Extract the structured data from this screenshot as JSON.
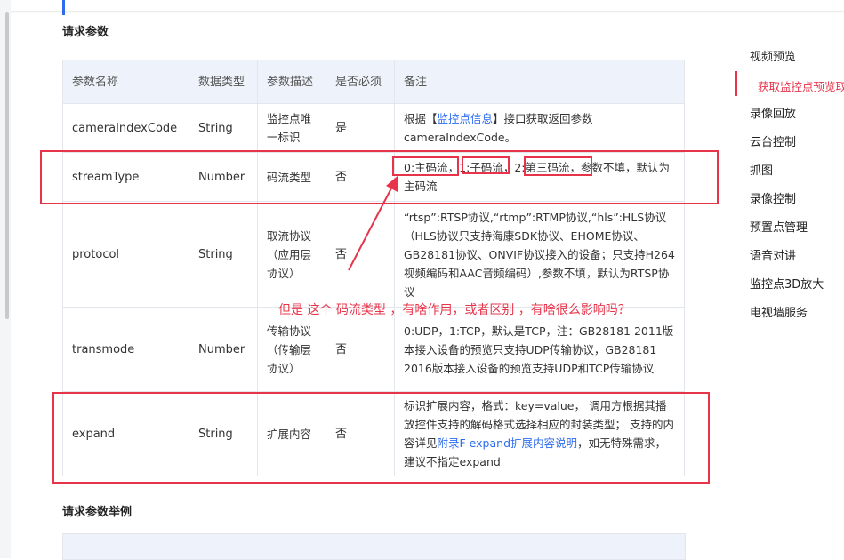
{
  "section_title": "请求参数",
  "table": {
    "headers": [
      "参数名称",
      "数据类型",
      "参数描述",
      "是否必须",
      "备注"
    ],
    "rows": [
      {
        "name": "cameraIndexCode",
        "type": "String",
        "desc": "监控点唯一标识",
        "required": "是",
        "note_prefix": "根据【",
        "note_link": "监控点信息",
        "note_suffix": "】接口获取返回参数cameraIndexCode。"
      },
      {
        "name": "streamType",
        "type": "Number",
        "desc": "码流类型",
        "required": "否",
        "note": "0:主码流，1:子码流，2:第三码流，参数不填，默认为主码流"
      },
      {
        "name": "protocol",
        "type": "String",
        "desc": "取流协议（应用层协议）",
        "required": "否",
        "note": "“rtsp”:RTSP协议,“rtmp”:RTMP协议,“hls”:HLS协议（HLS协议只支持海康SDK协议、EHOME协议、GB28181协议、ONVIF协议接入的设备；只支持H264视频编码和AAC音频编码）,参数不填，默认为RTSP协议"
      },
      {
        "name": "transmode",
        "type": "Number",
        "desc": "传输协议（传输层协议）",
        "required": "否",
        "note": "0:UDP，1:TCP，默认是TCP，注：GB28181 2011版本接入设备的预览只支持UDP传输协议，GB28181 2016版本接入设备的预览支持UDP和TCP传输协议"
      },
      {
        "name": "expand",
        "type": "String",
        "desc": "扩展内容",
        "required": "否",
        "note_prefix": "标识扩展内容，格式：key=value， 调用方根据其播放控件支持的解码格式选择相应的封装类型； 支持的内容详见",
        "note_link": "附录F expand扩展内容说明",
        "note_suffix": "，如无特殊需求，建议不指定expand"
      }
    ]
  },
  "example_title": "请求参数举例",
  "sidenav": {
    "items": [
      "视频预览",
      "录像回放",
      "云台控制",
      "抓图",
      "录像控制",
      "预置点管理",
      "语音对讲",
      "监控点3D放大",
      "电视墙服务"
    ],
    "active_sub": "获取监控点预览取流"
  },
  "annotation": "但是 这个 码流类型 ，有啥作用，或者区别 ，有啥很么影响吗？",
  "colors": {
    "accent": "#2d6cf0",
    "annotation_red": "#e8344a",
    "header_bg": "#eef3fb"
  }
}
